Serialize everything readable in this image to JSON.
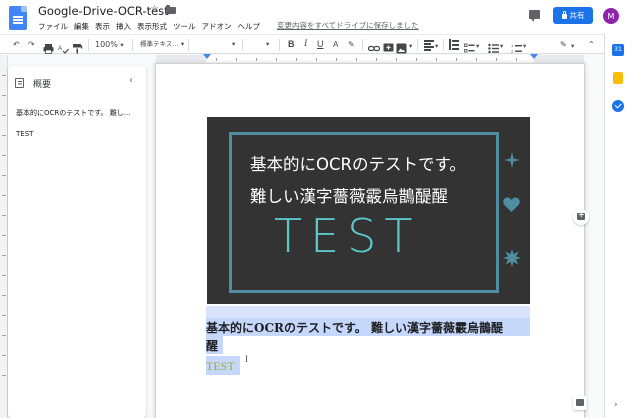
{
  "header": {
    "doc_title": "Google-Drive-OCR-test",
    "star_icon": "☆",
    "menus": [
      "ファイル",
      "編集",
      "表示",
      "挿入",
      "表示形式",
      "ツール",
      "アドオン",
      "ヘルプ"
    ],
    "save_notice": "変更内容をすべてドライブに保存しました",
    "share_label": "共有",
    "avatar_initial": "M"
  },
  "toolbar": {
    "undo": "↶",
    "redo": "↷",
    "zoom": "100%",
    "style": "標準テキス…",
    "bold": "B",
    "italic": "I",
    "underline": "U",
    "text_color": "A",
    "highlight": "✎",
    "pen": "✎",
    "collapse": "⌃",
    "caret": "▾"
  },
  "outline": {
    "title": "概要",
    "close": "‹",
    "items": [
      "基本的にOCRのテストです。 難し...",
      "TEST"
    ]
  },
  "image": {
    "line1": "基本的にOCRのテストです。",
    "line2": "難しい漢字薔薇霰烏鵲醍醒",
    "test": "TEST"
  },
  "document": {
    "line1": "基本的にOCRのテストです。 難しい漢字薔薇霰烏鵲醍",
    "line2": "醒",
    "line3": "TEST",
    "cursor": "I"
  },
  "side_panel": {
    "calendar_label": "31",
    "expand": "›"
  },
  "colors": {
    "brand_blue": "#1a73e8",
    "avatar": "#8e24aa",
    "image_bg": "#333333",
    "frame": "#4f8ea0",
    "test_text": "#5cc6c9",
    "selection": "#c6d7fc",
    "ocr_test_green": "#9dab2a"
  }
}
